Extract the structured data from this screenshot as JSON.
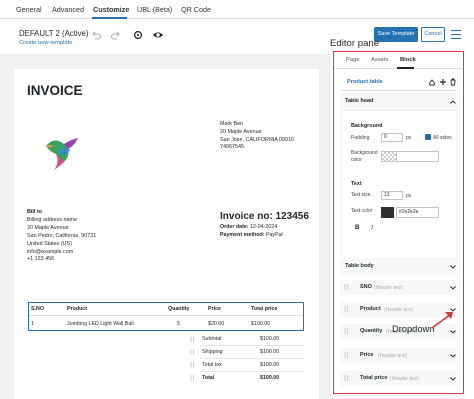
{
  "tabs": [
    "General",
    "Advanced",
    "Customize",
    "UBL (Beta)",
    "QR Code"
  ],
  "toolbar": {
    "title": "DEFAULT 2 (Active)",
    "link": "Create new template",
    "save_label": "Save Template",
    "cancel_label": "Cancel"
  },
  "annotation": {
    "pane_label": "Editor pane",
    "dropdown_label": "Dropdown"
  },
  "invoice": {
    "title": "INVOICE",
    "from": [
      "Mark Ben",
      "20 Maple Avenue",
      "San Jose, CALIFORNIA 00016",
      "74067545"
    ],
    "bill_to_heading": "Bill to",
    "bill_to": [
      "Billing address name",
      "20 Maple Avenue",
      "San Pedro, California, 90731",
      "United States (US)",
      "info@example.com",
      "+1 123 456"
    ],
    "number_label": "Invoice no: 123456",
    "order_date_label": "Order date:",
    "order_date": "12-04-2024",
    "payment_label": "Payment method:",
    "payment": "PayPal",
    "table_headers": [
      "S.NO",
      "Product",
      "Quantity",
      "Price",
      "Total price"
    ],
    "rows": [
      [
        "1",
        "Jumbing LED Light Wall Ball",
        "5",
        "$20.00",
        "$100.00"
      ]
    ],
    "summary": [
      {
        "label": "Subtotal",
        "value": "$100.00"
      },
      {
        "label": "Shipping",
        "value": "$100.00"
      },
      {
        "label": "Total tax",
        "value": "$100.00"
      },
      {
        "label": "Total",
        "value": "$100.00"
      }
    ]
  },
  "panel": {
    "tabs": [
      "Page",
      "Assets",
      "Block"
    ],
    "block_name": "Product table",
    "table_head": "Table head",
    "background": "Background",
    "padding_label": "Padding",
    "padding_value": "0",
    "padding_unit": "px",
    "all_sides": "All sides",
    "bg_color_label": "Background color",
    "text": "Text",
    "text_size_label": "Text size",
    "text_size_value": "13",
    "text_size_unit": "px",
    "text_color_label": "Text color",
    "text_color_value": "#2e2e2e",
    "bold": "B",
    "italic": "I",
    "table_body": "Table body",
    "columns": [
      {
        "name": "SNO",
        "hint": "(Header text)"
      },
      {
        "name": "Product",
        "hint": "(Header text)"
      },
      {
        "name": "Quantity",
        "hint": "(Header text)"
      },
      {
        "name": "Price",
        "hint": "(Header text)"
      },
      {
        "name": "Total price",
        "hint": "(Header text)"
      }
    ]
  },
  "colors": {
    "accent": "#2271b1",
    "highlight_border": "#d63638",
    "text_swatch": "#2e2e2e"
  }
}
